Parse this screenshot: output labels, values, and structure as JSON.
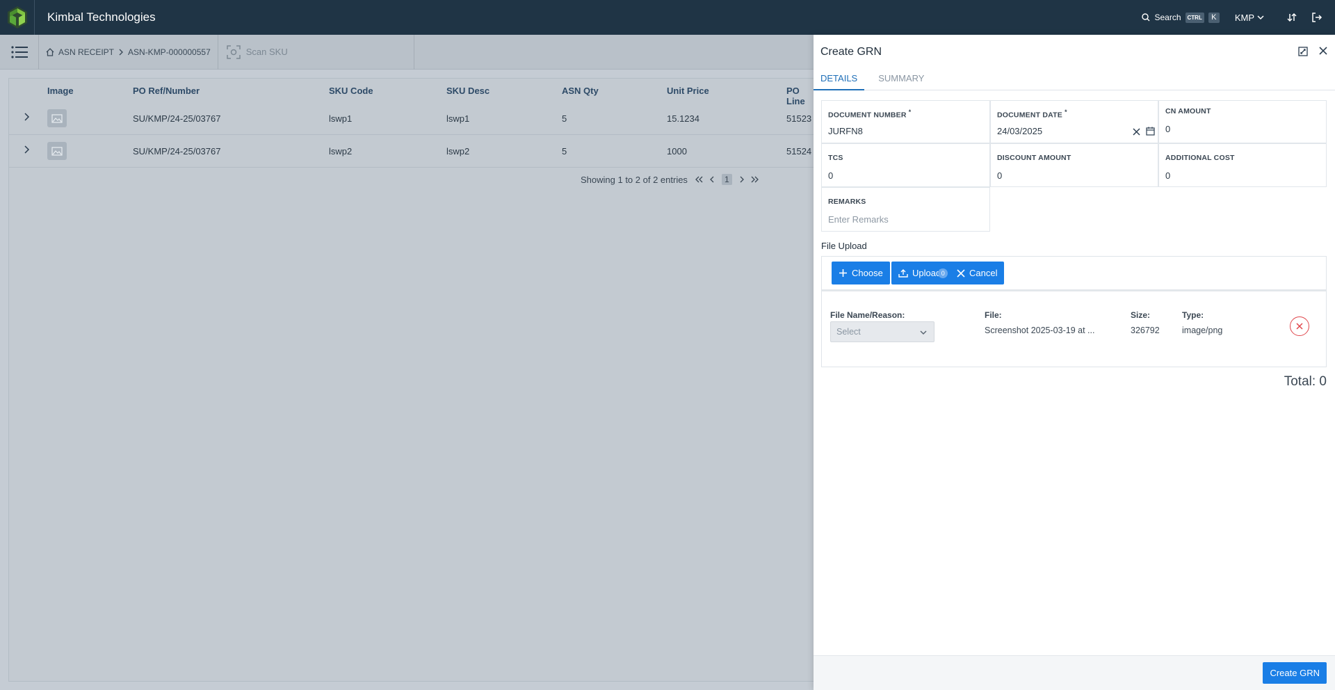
{
  "app": {
    "brand": "Kimbal Technologies",
    "search_label": "Search",
    "shortcut_ctrl": "CTRL",
    "shortcut_k": "K",
    "user": "KMP"
  },
  "subbar": {
    "crumb_root": "ASN RECEIPT",
    "crumb_current": "ASN-KMP-000000557",
    "scan_label": "Scan SKU"
  },
  "table": {
    "columns": [
      "Image",
      "PO Ref/Number",
      "SKU Code",
      "SKU Desc",
      "ASN Qty",
      "Unit Price",
      "PO Line"
    ],
    "rows": [
      {
        "po_ref": "SU/KMP/24-25/03767",
        "sku_code": "lswp1",
        "sku_desc": "lswp1",
        "asn_qty": "5",
        "unit_price": "15.1234",
        "po_line": "51523"
      },
      {
        "po_ref": "SU/KMP/24-25/03767",
        "sku_code": "lswp2",
        "sku_desc": "lswp2",
        "asn_qty": "5",
        "unit_price": "1000",
        "po_line": "51524"
      }
    ],
    "pager_text": "Showing 1 to 2 of 2 entries",
    "current_page": "1"
  },
  "drawer": {
    "title": "Create GRN",
    "tabs": [
      "DETAILS",
      "SUMMARY"
    ],
    "fields": {
      "document_number": {
        "label": "DOCUMENT NUMBER",
        "value": "JURFN8"
      },
      "document_date": {
        "label": "DOCUMENT DATE",
        "value": "24/03/2025"
      },
      "cn_amount": {
        "label": "CN AMOUNT",
        "value": "0"
      },
      "tcs": {
        "label": "TCS",
        "value": "0"
      },
      "discount_amount": {
        "label": "DISCOUNT AMOUNT",
        "value": "0"
      },
      "additional_cost": {
        "label": "ADDITIONAL COST",
        "value": "0"
      },
      "remarks": {
        "label": "REMARKS",
        "placeholder": "Enter Remarks"
      }
    },
    "file_upload": {
      "title": "File Upload",
      "choose_label": "Choose",
      "upload_label": "Upload",
      "upload_badge": "0",
      "cancel_label": "Cancel",
      "file_name_label": "File Name/Reason:",
      "select_placeholder": "Select",
      "file_label": "File:",
      "file_value": "Screenshot 2025-03-19 at ...",
      "size_label": "Size:",
      "size_value": "326792",
      "type_label": "Type:",
      "type_value": "image/png"
    },
    "total_text": "Total: 0",
    "create_label": "Create GRN"
  },
  "colors": {
    "topbar": "#1f3445",
    "accent": "#1a7ee6",
    "danger": "#e0474c"
  }
}
